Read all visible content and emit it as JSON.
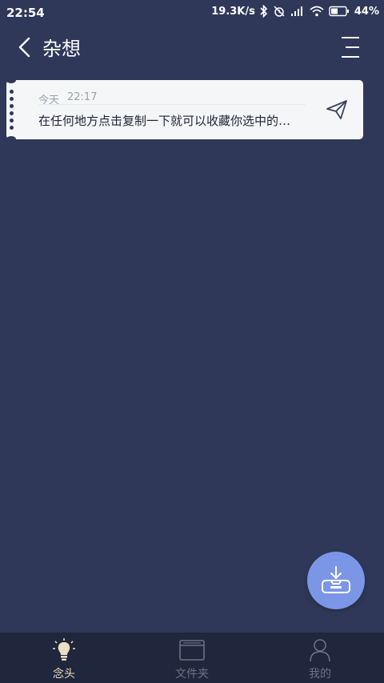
{
  "status_bar": {
    "time": "22:54",
    "network_speed": "19.3K/s",
    "battery": "44%",
    "icons": [
      "bluetooth-icon",
      "alarm-off-icon",
      "signal-icon",
      "wifi-icon",
      "battery-icon"
    ]
  },
  "app_bar": {
    "title": "杂想",
    "back_icon": "chevron-left-icon",
    "menu_icon": "menu-lines-icon"
  },
  "notes": [
    {
      "date": "今天",
      "time": "22:17",
      "text": "在任何地方点击复制一下就可以收藏你选中的文字",
      "action_icon": "send-icon"
    }
  ],
  "fab": {
    "icon": "inbox-download-icon"
  },
  "bottom_nav": {
    "items": [
      {
        "label": "念头",
        "icon": "lightbulb-icon",
        "active": true
      },
      {
        "label": "文件夹",
        "icon": "folder-icon",
        "active": false
      },
      {
        "label": "我的",
        "icon": "person-icon",
        "active": false
      }
    ]
  },
  "colors": {
    "background": "#2f3858",
    "card": "#f5f6f8",
    "fab": "#7b96e6",
    "nav_bg": "#20263b",
    "nav_active": "#eadfc4",
    "nav_inactive": "#6c7186"
  }
}
